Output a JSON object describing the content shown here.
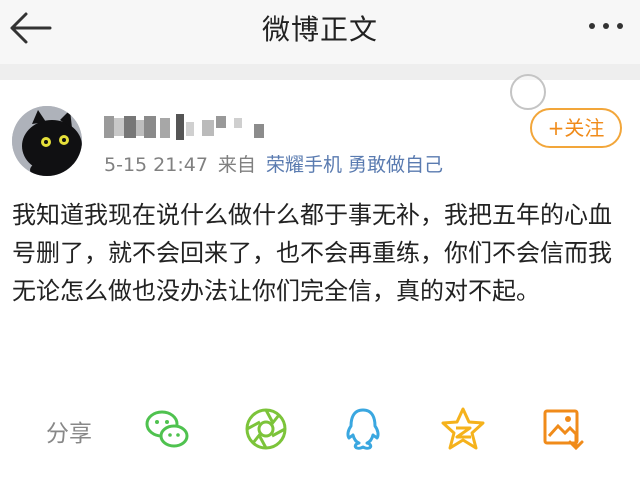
{
  "header": {
    "title": "微博正文",
    "back_icon": "back-arrow-icon",
    "more_icon": "more-dots-icon"
  },
  "post": {
    "meta_time": "5-15 21:47",
    "meta_from": "来自",
    "meta_source": "荣耀手机 勇敢做自己",
    "follow_label": "+关注",
    "content": "我知道我现在说什么做什么都于事无补，我把五年的心血号删了，就不会回来了，也不会再重练，你们不会信而我无论怎么做也没办法让你们完全信，真的对不起。"
  },
  "share": {
    "label": "分享",
    "targets": [
      "wechat-icon",
      "moments-icon",
      "qq-icon",
      "qzone-icon",
      "save-image-icon"
    ]
  },
  "colors": {
    "accent": "#f2a63a",
    "wechat": "#4fc24f",
    "moments": "#7cc43a",
    "qq": "#3aa7e0",
    "qzone": "#f5b21c",
    "save": "#f08b1a"
  }
}
